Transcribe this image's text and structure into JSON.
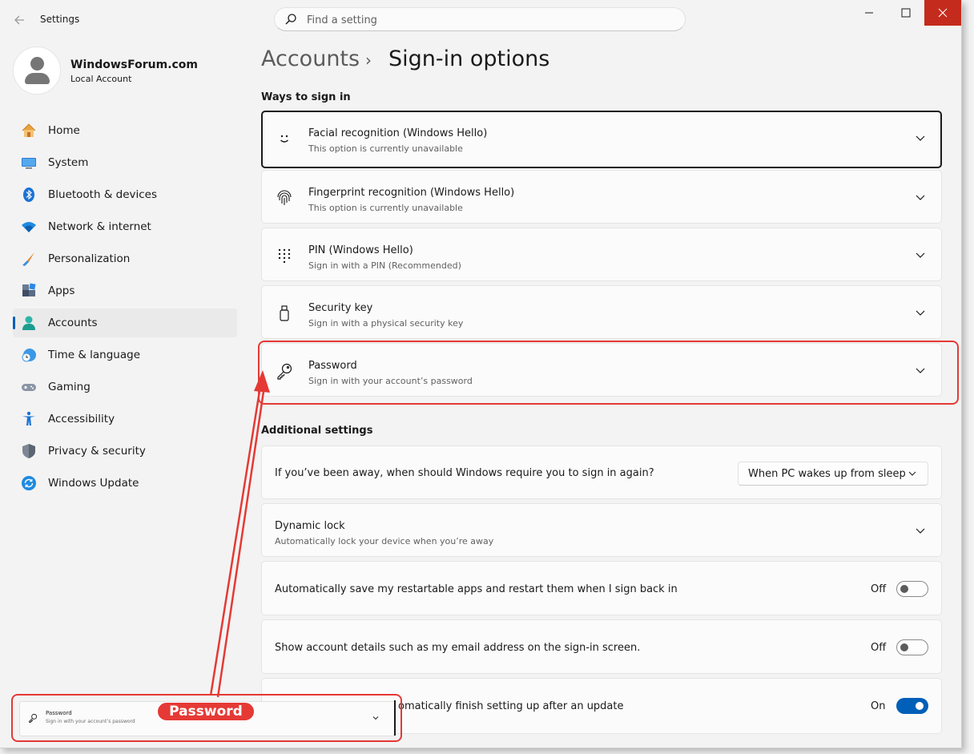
{
  "window": {
    "title": "Settings",
    "back_icon": "back-arrow-icon",
    "controls": {
      "minimize": "–",
      "maximize": "□",
      "close": "✕"
    }
  },
  "search": {
    "placeholder": "Find a setting",
    "icon": "search-icon"
  },
  "profile": {
    "name": "WindowsForum.com",
    "account_type": "Local Account"
  },
  "sidebar": {
    "items": [
      {
        "label": "Home",
        "icon": "home-icon",
        "active": false
      },
      {
        "label": "System",
        "icon": "system-icon",
        "active": false
      },
      {
        "label": "Bluetooth & devices",
        "icon": "bluetooth-icon",
        "active": false
      },
      {
        "label": "Network & internet",
        "icon": "wifi-icon",
        "active": false
      },
      {
        "label": "Personalization",
        "icon": "brush-icon",
        "active": false
      },
      {
        "label": "Apps",
        "icon": "apps-icon",
        "active": false
      },
      {
        "label": "Accounts",
        "icon": "accounts-icon",
        "active": true
      },
      {
        "label": "Time & language",
        "icon": "globe-clock-icon",
        "active": false
      },
      {
        "label": "Gaming",
        "icon": "gamepad-icon",
        "active": false
      },
      {
        "label": "Accessibility",
        "icon": "accessibility-icon",
        "active": false
      },
      {
        "label": "Privacy & security",
        "icon": "shield-icon",
        "active": false
      },
      {
        "label": "Windows Update",
        "icon": "update-icon",
        "active": false
      }
    ]
  },
  "breadcrumb": {
    "parent": "Accounts",
    "separator": "›",
    "current": "Sign-in options"
  },
  "ways_to_sign_in": {
    "heading": "Ways to sign in",
    "options": [
      {
        "title": "Facial recognition (Windows Hello)",
        "subtitle": "This option is currently unavailable",
        "icon": "face-icon"
      },
      {
        "title": "Fingerprint recognition (Windows Hello)",
        "subtitle": "This option is currently unavailable",
        "icon": "fingerprint-icon"
      },
      {
        "title": "PIN (Windows Hello)",
        "subtitle": "Sign in with a PIN (Recommended)",
        "icon": "pin-keypad-icon"
      },
      {
        "title": "Security key",
        "subtitle": "Sign in with a physical security key",
        "icon": "usb-key-icon"
      },
      {
        "title": "Password",
        "subtitle": "Sign in with your account’s password",
        "icon": "key-icon"
      }
    ]
  },
  "additional_settings": {
    "heading": "Additional settings",
    "require_signin": {
      "label": "If you’ve been away, when should Windows require you to sign in again?",
      "selected": "When PC wakes up from sleep"
    },
    "dynamic_lock": {
      "title": "Dynamic lock",
      "subtitle": "Automatically lock your device when you’re away"
    },
    "restart_apps": {
      "label": "Automatically save my restartable apps and restart them when I sign back in",
      "state": "Off"
    },
    "account_details": {
      "label": "Show account details such as my email address on the sign-in screen.",
      "state": "Off"
    },
    "finish_setup": {
      "label": "omatically finish setting up after an update",
      "state": "On"
    }
  },
  "annotation": {
    "callout_label": "Password",
    "inset_title": "Password",
    "inset_subtitle": "Sign in with your account’s password",
    "color": "#e53935"
  },
  "colors": {
    "accent": "#005fb8",
    "close_button": "#c42b1c"
  }
}
